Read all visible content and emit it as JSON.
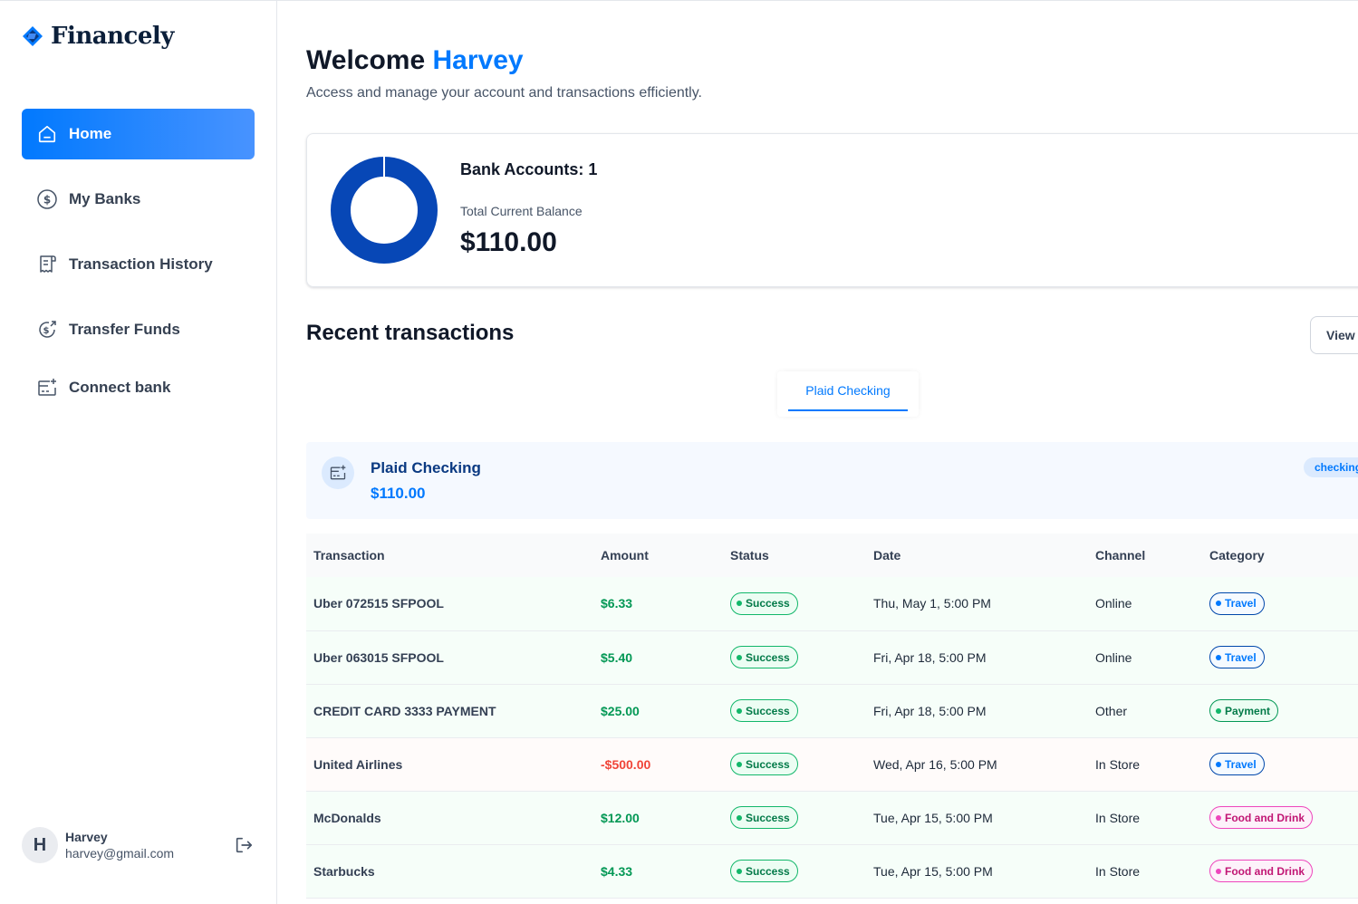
{
  "brand": {
    "name": "Financely",
    "color": "#0179fe"
  },
  "sidebar": {
    "items": [
      {
        "label": "Home",
        "icon": "home-icon",
        "active": true
      },
      {
        "label": "My Banks",
        "icon": "dollar-circle-icon"
      },
      {
        "label": "Transaction History",
        "icon": "receipt-icon"
      },
      {
        "label": "Transfer Funds",
        "icon": "money-send-icon"
      },
      {
        "label": "Connect bank",
        "icon": "card-add-icon"
      }
    ],
    "user": {
      "initial": "H",
      "name": "Harvey",
      "email": "harvey@gmail.com"
    }
  },
  "header": {
    "greeting": "Welcome",
    "user_name": "Harvey",
    "subtitle": "Access and manage your account and transactions efficiently."
  },
  "balance": {
    "accounts_label": "Bank Accounts: 1",
    "total_label": "Total Current Balance",
    "total_value": "$110.00",
    "donut_color": "#0747b6"
  },
  "recent": {
    "title": "Recent transactions",
    "view_all": "View",
    "tabs": [
      {
        "label": "Plaid Checking",
        "active": true
      }
    ],
    "bank": {
      "name": "Plaid Checking",
      "balance": "$110.00",
      "type": "checking"
    },
    "columns": [
      "Transaction",
      "Amount",
      "Status",
      "Date",
      "Channel",
      "Category"
    ],
    "rows": [
      {
        "name": "Uber 072515 SFPOOL",
        "amount": "$6.33",
        "status": "Success",
        "date": "Thu, May 1, 5:00 PM",
        "channel": "Online",
        "category": "Travel"
      },
      {
        "name": "Uber 063015 SFPOOL",
        "amount": "$5.40",
        "status": "Success",
        "date": "Fri, Apr 18, 5:00 PM",
        "channel": "Online",
        "category": "Travel"
      },
      {
        "name": "CREDIT CARD 3333 PAYMENT",
        "amount": "$25.00",
        "status": "Success",
        "date": "Fri, Apr 18, 5:00 PM",
        "channel": "Other",
        "category": "Payment"
      },
      {
        "name": "United Airlines",
        "amount": "-$500.00",
        "status": "Success",
        "date": "Wed, Apr 16, 5:00 PM",
        "channel": "In Store",
        "category": "Travel"
      },
      {
        "name": "McDonalds",
        "amount": "$12.00",
        "status": "Success",
        "date": "Tue, Apr 15, 5:00 PM",
        "channel": "In Store",
        "category": "Food and Drink"
      },
      {
        "name": "Starbucks",
        "amount": "$4.33",
        "status": "Success",
        "date": "Tue, Apr 15, 5:00 PM",
        "channel": "In Store",
        "category": "Food and Drink"
      }
    ]
  }
}
